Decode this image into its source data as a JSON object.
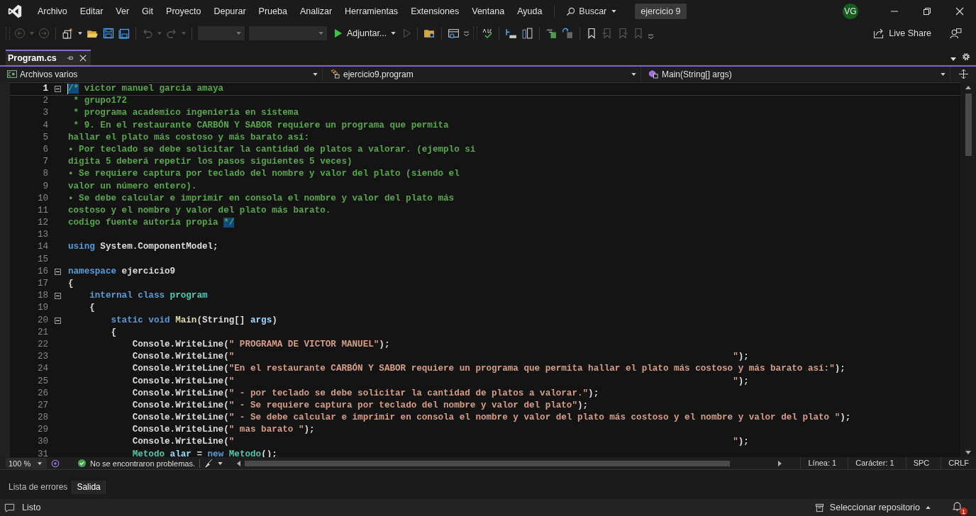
{
  "window": {
    "menu": [
      "Archivo",
      "Editar",
      "Ver",
      "Git",
      "Proyecto",
      "Depurar",
      "Prueba",
      "Analizar",
      "Herramientas",
      "Extensiones",
      "Ventana",
      "Ayuda"
    ],
    "search": "Buscar",
    "solution": "ejercicio 9",
    "avatar": "VG"
  },
  "toolbar": {
    "start": "Adjuntar...",
    "live_share": "Live Share"
  },
  "tabs": [
    {
      "label": "Program.cs",
      "selected": true
    }
  ],
  "navigation": [
    "Archivos varios",
    "ejercicio9.program",
    "Main(String[] args)"
  ],
  "editor": {
    "lines": [
      {
        "number": "1",
        "fold": true,
        "tokens": [
          {
            "kind": "match",
            "text": "/*"
          },
          {
            "kind": "comment",
            "text": " victor manuel garcia amaya"
          }
        ]
      },
      {
        "number": "2",
        "fold": false,
        "tokens": [
          {
            "kind": "comment",
            "text": " * grupo172"
          }
        ]
      },
      {
        "number": "3",
        "fold": false,
        "tokens": [
          {
            "kind": "comment",
            "text": " * programa academico ingenieria en sistema"
          }
        ]
      },
      {
        "number": "4",
        "fold": false,
        "tokens": [
          {
            "kind": "comment",
            "text": " * 9. En el restaurante CARBÓN Y SABOR requiere un programa que permita"
          }
        ]
      },
      {
        "number": "5",
        "fold": false,
        "tokens": [
          {
            "kind": "comment",
            "text": "hallar el plato más costoso y más barato así:"
          }
        ]
      },
      {
        "number": "6",
        "fold": false,
        "tokens": [
          {
            "kind": "comment",
            "text": "• Por teclado se debe solicitar la cantidad de platos a valorar. (ejemplo si"
          }
        ]
      },
      {
        "number": "7",
        "fold": false,
        "tokens": [
          {
            "kind": "comment",
            "text": "digita 5 deberá repetir los pasos siguientes 5 veces)"
          }
        ]
      },
      {
        "number": "8",
        "fold": false,
        "tokens": [
          {
            "kind": "comment",
            "text": "• Se requiere captura por teclado del nombre y valor del plato (siendo el"
          }
        ]
      },
      {
        "number": "9",
        "fold": false,
        "tokens": [
          {
            "kind": "comment",
            "text": "valor un número entero)."
          }
        ]
      },
      {
        "number": "10",
        "fold": false,
        "tokens": [
          {
            "kind": "comment",
            "text": "• Se debe calcular e imprimir en consola el nombre y valor del plato más"
          }
        ]
      },
      {
        "number": "11",
        "fold": false,
        "tokens": [
          {
            "kind": "comment",
            "text": "costoso y el nombre y valor del plato más barato."
          }
        ]
      },
      {
        "number": "12",
        "fold": false,
        "tokens": [
          {
            "kind": "comment",
            "text": "codigo fuente autoria propia "
          },
          {
            "kind": "match",
            "text": "*/"
          }
        ]
      },
      {
        "number": "13",
        "fold": false
      },
      {
        "number": "14",
        "fold": false,
        "tokens": [
          {
            "kind": "keyword",
            "text": "using"
          },
          {
            "kind": "plain",
            "text": " System.ComponentModel;"
          }
        ]
      },
      {
        "number": "15",
        "fold": false
      },
      {
        "number": "16",
        "fold": true,
        "tokens": [
          {
            "kind": "keyword",
            "text": "namespace"
          },
          {
            "kind": "plain",
            "text": " ejercicio9"
          }
        ]
      },
      {
        "number": "17",
        "fold": false,
        "tokens": [
          {
            "kind": "plain",
            "text": "{"
          }
        ]
      },
      {
        "number": "18",
        "fold": true,
        "tokens": [
          {
            "kind": "keyword",
            "text": "    internal class"
          },
          {
            "kind": "type",
            "text": " program"
          }
        ]
      },
      {
        "number": "19",
        "fold": false,
        "tokens": [
          {
            "kind": "plain",
            "text": "    {"
          }
        ]
      },
      {
        "number": "20",
        "fold": true,
        "tokens": [
          {
            "kind": "keyword",
            "text": "        static void"
          },
          {
            "kind": "method",
            "text": " Main"
          },
          {
            "kind": "plain",
            "text": "(String[] "
          },
          {
            "kind": "param",
            "text": "args"
          },
          {
            "kind": "plain",
            "text": ")"
          }
        ]
      },
      {
        "number": "21",
        "fold": false,
        "tokens": [
          {
            "kind": "plain",
            "text": "        {"
          }
        ]
      },
      {
        "number": "22",
        "fold": false,
        "tokens": [
          {
            "kind": "plain",
            "text": "            Console.WriteLine("
          },
          {
            "kind": "string",
            "text": "\" PROGRAMA DE VICTOR MANUEL\""
          },
          {
            "kind": "plain",
            "text": ");"
          }
        ]
      },
      {
        "number": "23",
        "fold": false,
        "tokens": [
          {
            "kind": "plain",
            "text": "            Console.WriteLine("
          },
          {
            "kind": "string",
            "text": "\"                                                                                             \""
          },
          {
            "kind": "plain",
            "text": ");"
          }
        ]
      },
      {
        "number": "24",
        "fold": false,
        "tokens": [
          {
            "kind": "plain",
            "text": "            Console.WriteLine("
          },
          {
            "kind": "string",
            "text": "\"En el restaurante CARBÓN Y SABOR requiere un programa que permita hallar el plato más costoso y más barato así:\""
          },
          {
            "kind": "plain",
            "text": ");"
          }
        ]
      },
      {
        "number": "25",
        "fold": false,
        "tokens": [
          {
            "kind": "plain",
            "text": "            Console.WriteLine("
          },
          {
            "kind": "string",
            "text": "\"                                                                                             \""
          },
          {
            "kind": "plain",
            "text": ");"
          }
        ]
      },
      {
        "number": "26",
        "fold": false,
        "tokens": [
          {
            "kind": "plain",
            "text": "            Console.WriteLine("
          },
          {
            "kind": "string",
            "text": "\" - por teclado se debe solicitar la cantidad de platos a valorar.\""
          },
          {
            "kind": "plain",
            "text": ");"
          }
        ]
      },
      {
        "number": "27",
        "fold": false,
        "tokens": [
          {
            "kind": "plain",
            "text": "            Console.WriteLine("
          },
          {
            "kind": "string",
            "text": "\" - Se requiere captura por teclado del nombre y valor del plato\""
          },
          {
            "kind": "plain",
            "text": ");"
          }
        ]
      },
      {
        "number": "28",
        "fold": false,
        "tokens": [
          {
            "kind": "plain",
            "text": "            Console.WriteLine("
          },
          {
            "kind": "string",
            "text": "\" - Se debe calcular e imprimir en consola el nombre y valor del plato más costoso y el nombre y valor del plato \""
          },
          {
            "kind": "plain",
            "text": ");"
          }
        ]
      },
      {
        "number": "29",
        "fold": false,
        "tokens": [
          {
            "kind": "plain",
            "text": "            Console.WriteLine("
          },
          {
            "kind": "string",
            "text": "\" mas barato \""
          },
          {
            "kind": "plain",
            "text": ");"
          }
        ]
      },
      {
        "number": "30",
        "fold": false,
        "tokens": [
          {
            "kind": "plain",
            "text": "            Console.WriteLine("
          },
          {
            "kind": "string",
            "text": "\"                                                                                             \""
          },
          {
            "kind": "plain",
            "text": ");"
          }
        ]
      },
      {
        "number": "31",
        "fold": false,
        "tokens": [
          {
            "kind": "type",
            "text": "            Metodo"
          },
          {
            "kind": "param",
            "text": " alar"
          },
          {
            "kind": "plain",
            "text": " = "
          },
          {
            "kind": "keyword",
            "text": "new"
          },
          {
            "kind": "type",
            "text": " Metodo"
          },
          {
            "kind": "plain",
            "text": "();"
          }
        ]
      }
    ]
  },
  "editor_status": {
    "zoom": "100 %",
    "issues": "No se encontraron problemas.",
    "line": "Línea: 1",
    "column": "Carácter: 1",
    "whitespace": "SPC",
    "line_ending": "CRLF"
  },
  "panel_tabs": [
    {
      "label": "Lista de errores",
      "selected": false
    },
    {
      "label": "Salida",
      "selected": true
    }
  ],
  "status_bar": {
    "text": "Listo",
    "repository": "Seleccionar repositorio",
    "notifications": "1"
  }
}
